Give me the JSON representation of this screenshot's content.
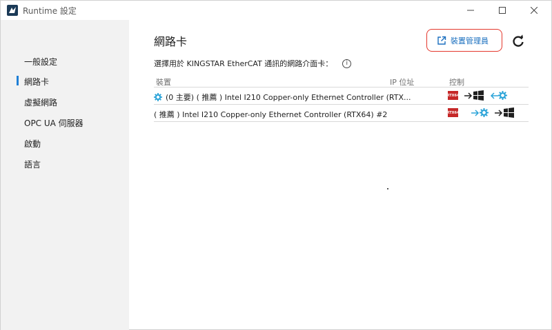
{
  "window": {
    "title": "Runtime 設定",
    "controls": {
      "minimize": "—",
      "maximize": "☐",
      "close": "✕"
    }
  },
  "sidebar": {
    "items": [
      {
        "label": "一般設定",
        "active": false
      },
      {
        "label": "網路卡",
        "active": true
      },
      {
        "label": "虛擬網路",
        "active": false
      },
      {
        "label": "OPC UA 伺服器",
        "active": false
      },
      {
        "label": "啟動",
        "active": false
      },
      {
        "label": "語言",
        "active": false
      }
    ]
  },
  "main": {
    "title": "網路卡",
    "device_manager_label": "裝置管理員",
    "description": "選擇用於 KINGSTAR EtherCAT 通訊的網路介面卡：",
    "table": {
      "headers": {
        "device": "裝置",
        "ip": "IP 位址",
        "control": "控制"
      },
      "rows": [
        {
          "name": "(0 主要) ( 推薦 ) Intel I210 Copper-only Ethernet Controller (RTX...",
          "ip": "",
          "badge": "RTX64",
          "state": "rtx"
        },
        {
          "name": "( 推薦 ) Intel I210 Copper-only Ethernet Controller (RTX64) #2",
          "ip": "",
          "badge": "RTX64",
          "state": "windows"
        }
      ]
    }
  },
  "colors": {
    "accent": "#1f7fd6",
    "highlight_border": "#e4362b",
    "rtx_badge": "#c62828",
    "gear": "#2aa3d8"
  }
}
